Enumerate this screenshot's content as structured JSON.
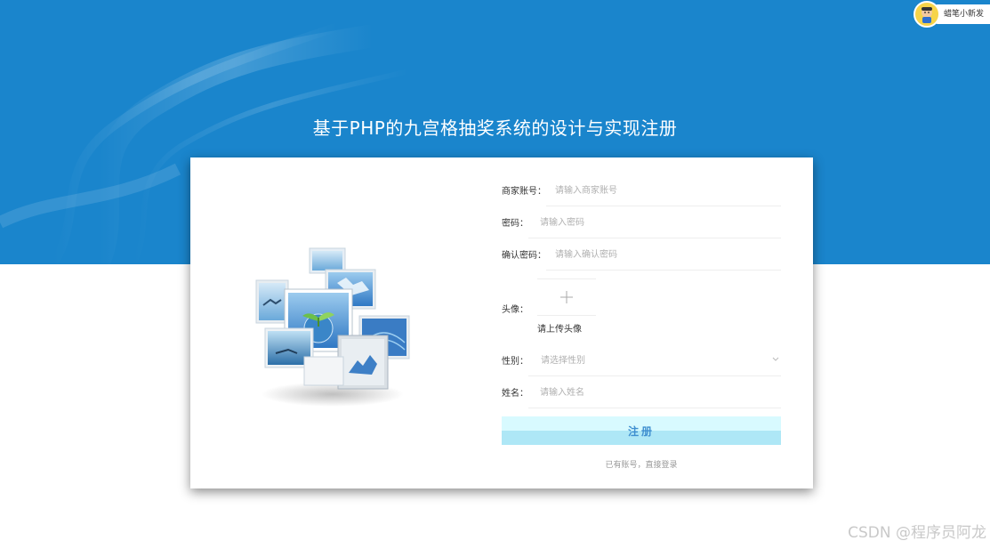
{
  "corner_badge": {
    "label": "蜡笔小新发"
  },
  "page": {
    "title": "基于PHP的九宫格抽奖系统的设计与实现注册"
  },
  "form": {
    "account": {
      "label": "商家账号：",
      "placeholder": "请输入商家账号"
    },
    "password": {
      "label": "密码：",
      "placeholder": "请输入密码"
    },
    "confirm_password": {
      "label": "确认密码：",
      "placeholder": "请输入确认密码"
    },
    "avatar": {
      "label": "头像：",
      "upload_hint": "请上传头像"
    },
    "gender": {
      "label": "性别：",
      "placeholder": "请选择性别"
    },
    "name": {
      "label": "姓名：",
      "placeholder": "请输入姓名"
    },
    "submit_label": "注册",
    "login_link": "已有账号，直接登录"
  },
  "watermark": "CSDN @程序员阿龙",
  "colors": {
    "banner": "#1a85cc",
    "button_top": "#d8faff",
    "button_bottom": "#aee7f6",
    "button_text": "#3f8fd0"
  },
  "icons": {
    "avatar_upload": "plus-icon",
    "gender_select": "chevron-down-icon",
    "corner_avatar": "cartoon-avatar-icon"
  }
}
